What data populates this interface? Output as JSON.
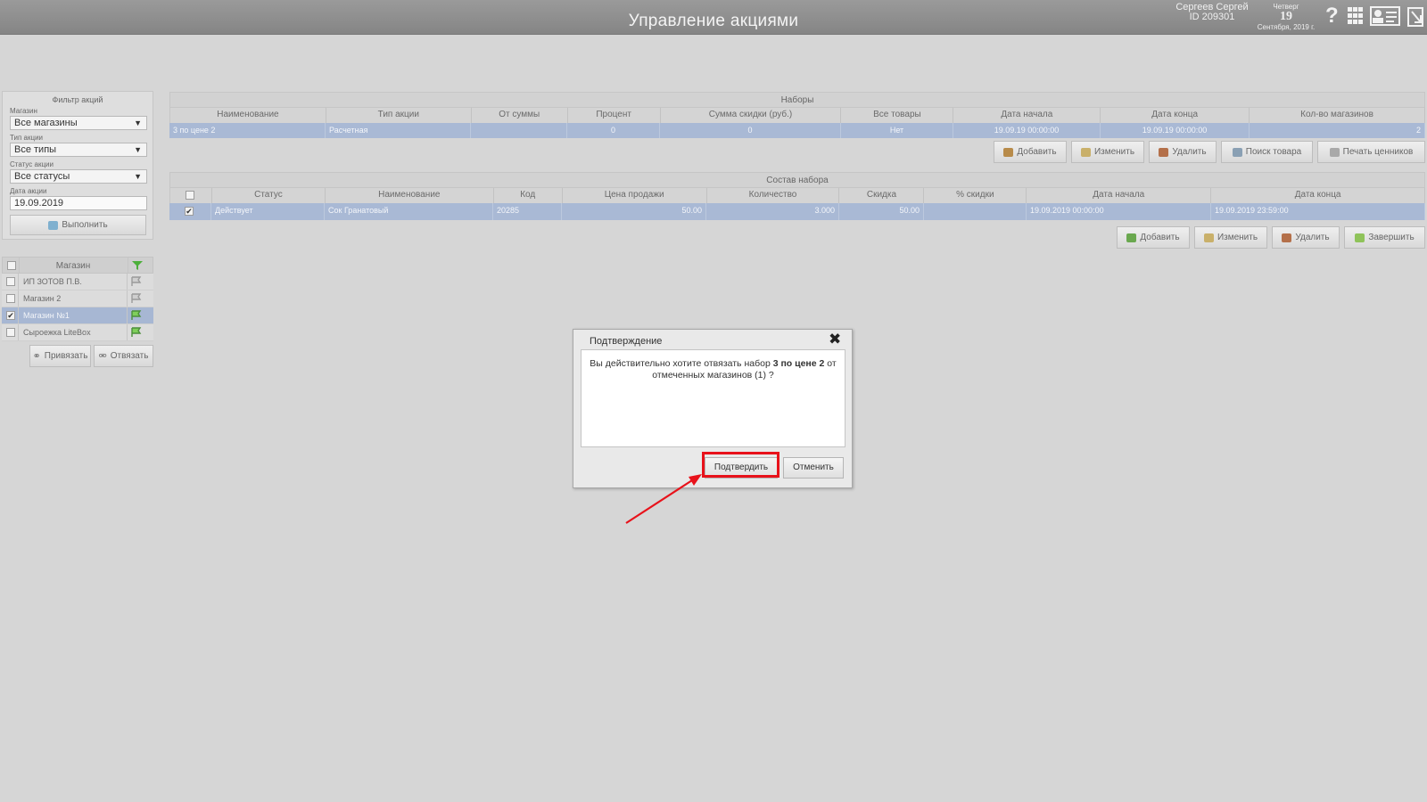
{
  "header": {
    "title": "Управление акциями",
    "user_name": "Сергеев Сергей",
    "user_id": "ID 209301",
    "weekday": "Четверг",
    "day": "19",
    "month_year": "Сентября, 2019 г."
  },
  "filter": {
    "title": "Фильтр акций",
    "store_label": "Магазин",
    "store_value": "Все магазины",
    "type_label": "Тип акции",
    "type_value": "Все типы",
    "status_label": "Статус акции",
    "status_value": "Все статусы",
    "date_label": "Дата акции",
    "date_value": "19.09.2019",
    "run_label": "Выполнить"
  },
  "stores": {
    "header": "Магазин",
    "items": [
      {
        "name": "ИП ЗОТОВ П.В.",
        "checked": false
      },
      {
        "name": "Магазин 2",
        "checked": false
      },
      {
        "name": "Магазин №1",
        "checked": true
      },
      {
        "name": "Сыроежка LiteBox",
        "checked": false
      }
    ],
    "bind_label": "Привязать",
    "unbind_label": "Отвязать"
  },
  "sets": {
    "title": "Наборы",
    "columns": [
      "Наименование",
      "Тип акции",
      "От суммы",
      "Процент",
      "Сумма скидки (руб.)",
      "Все товары",
      "Дата начала",
      "Дата конца",
      "Кол-во магазинов"
    ],
    "rows": [
      [
        "3 по цене 2",
        "Расчетная",
        "",
        "0",
        "0",
        "Нет",
        "19.09.19 00:00:00",
        "19.09.19 00:00:00",
        "2"
      ]
    ],
    "buttons": {
      "add": "Добавить",
      "edit": "Изменить",
      "delete": "Удалить",
      "find": "Поиск товара",
      "print": "Печать ценников"
    }
  },
  "composition": {
    "title": "Состав набора",
    "columns": [
      "",
      "Статус",
      "Наименование",
      "Код",
      "Цена продажи",
      "Количество",
      "Скидка",
      "% скидки",
      "Дата начала",
      "Дата конца"
    ],
    "rows": [
      [
        "✔",
        "Действует",
        "Сок Гранатовый",
        "20285",
        "50.00",
        "3.000",
        "50.00",
        "",
        "19.09.2019 00:00:00",
        "19.09.2019 23:59:00"
      ]
    ],
    "buttons": {
      "add": "Добавить",
      "edit": "Изменить",
      "delete": "Удалить",
      "finish": "Завершить"
    }
  },
  "dialog": {
    "title": "Подтверждение",
    "message_pre": "Вы действительно хотите отвязать набор ",
    "set_name": "3 по цене 2",
    "message_post": " от отмеченных магазинов (1) ?",
    "confirm_label": "Подтвердить",
    "cancel_label": "Отменить"
  },
  "colors": {
    "header": "#8f8f8f",
    "selected_row": "#a9b9d5",
    "highlight": "#e8121b"
  }
}
